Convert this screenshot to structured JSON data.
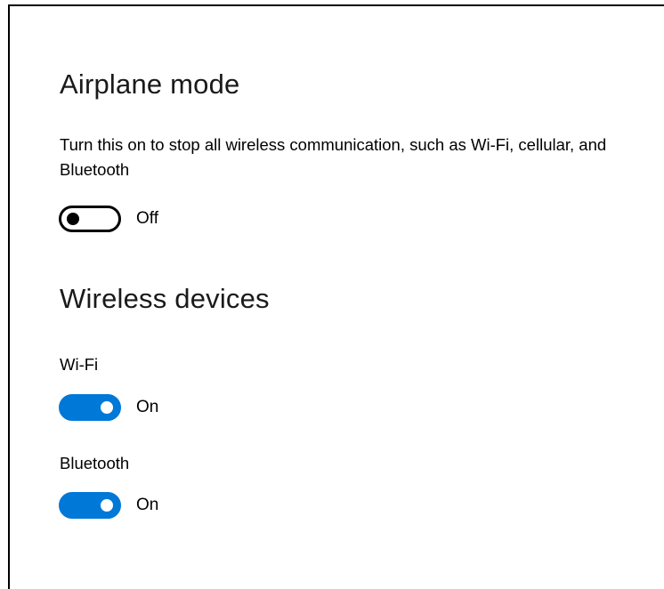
{
  "airplane": {
    "title": "Airplane mode",
    "description": "Turn this on to stop all wireless communication, such as Wi-Fi, cellular, and Bluetooth",
    "toggle_state": "Off",
    "is_on": false
  },
  "wireless": {
    "title": "Wireless devices",
    "wifi": {
      "label": "Wi-Fi",
      "toggle_state": "On",
      "is_on": true
    },
    "bluetooth": {
      "label": "Bluetooth",
      "toggle_state": "On",
      "is_on": true
    }
  },
  "colors": {
    "accent": "#0078d7",
    "text": "#000000",
    "background": "#ffffff"
  }
}
